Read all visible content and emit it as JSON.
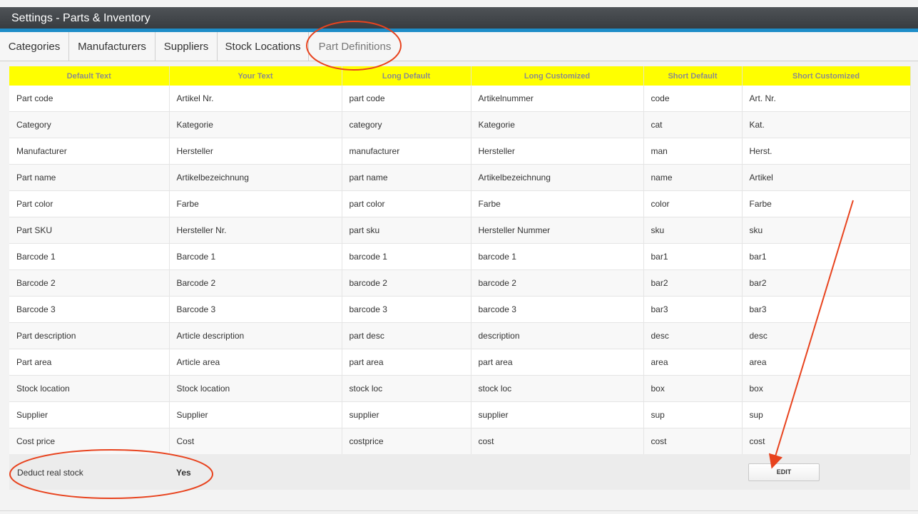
{
  "window": {
    "title": "Settings - Parts & Inventory"
  },
  "tabs": [
    {
      "label": "Categories"
    },
    {
      "label": "Manufacturers"
    },
    {
      "label": "Suppliers"
    },
    {
      "label": "Stock Locations"
    },
    {
      "label": "Part Definitions",
      "active": true
    }
  ],
  "table": {
    "headers": [
      "Default Text",
      "Your Text",
      "Long Default",
      "Long Customized",
      "Short Default",
      "Short Customized"
    ],
    "rows": [
      [
        "Part code",
        "Artikel Nr.",
        "part code",
        "Artikelnummer",
        "code",
        "Art. Nr."
      ],
      [
        "Category",
        "Kategorie",
        "category",
        "Kategorie",
        "cat",
        "Kat."
      ],
      [
        "Manufacturer",
        "Hersteller",
        "manufacturer",
        "Hersteller",
        "man",
        "Herst."
      ],
      [
        "Part name",
        "Artikelbezeichnung",
        "part name",
        "Artikelbezeichnung",
        "name",
        "Artikel"
      ],
      [
        "Part color",
        "Farbe",
        "part color",
        "Farbe",
        "color",
        "Farbe"
      ],
      [
        "Part SKU",
        "Hersteller Nr.",
        "part sku",
        "Hersteller Nummer",
        "sku",
        "sku"
      ],
      [
        "Barcode 1",
        "Barcode 1",
        "barcode 1",
        "barcode 1",
        "bar1",
        "bar1"
      ],
      [
        "Barcode 2",
        "Barcode 2",
        "barcode 2",
        "barcode 2",
        "bar2",
        "bar2"
      ],
      [
        "Barcode 3",
        "Barcode 3",
        "barcode 3",
        "barcode 3",
        "bar3",
        "bar3"
      ],
      [
        "Part description",
        "Article description",
        "part desc",
        "description",
        "desc",
        "desc"
      ],
      [
        "Part area",
        "Article area",
        "part area",
        "part area",
        "area",
        "area"
      ],
      [
        "Stock location",
        "Stock location",
        "stock loc",
        "stock loc",
        "box",
        "box"
      ],
      [
        "Supplier",
        "Supplier",
        "supplier",
        "supplier",
        "sup",
        "sup"
      ],
      [
        "Cost price",
        "Cost",
        "costprice",
        "cost",
        "cost",
        "cost"
      ]
    ]
  },
  "footer": {
    "deduct_label": "Deduct real stock",
    "deduct_value": "Yes",
    "edit_label": "EDIT"
  },
  "colors": {
    "header_bar": "#3d4145",
    "accent": "#1e8dc8",
    "table_header": "#ffff00",
    "annotation": "#e8431e"
  }
}
